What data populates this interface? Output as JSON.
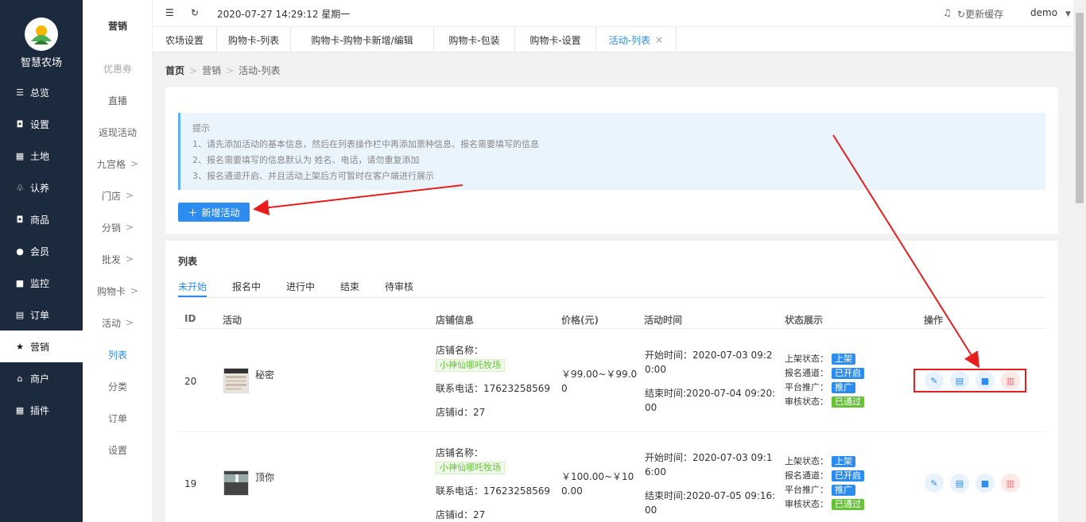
{
  "brand": {
    "name": "智慧农场"
  },
  "sidebar": {
    "items": [
      {
        "label": "总览",
        "icon": "sliders-icon"
      },
      {
        "label": "设置",
        "icon": "bag-icon"
      },
      {
        "label": "土地",
        "icon": "grid-icon"
      },
      {
        "label": "认养",
        "icon": "tree-icon"
      },
      {
        "label": "商品",
        "icon": "bag-icon"
      },
      {
        "label": "会员",
        "icon": "user-icon"
      },
      {
        "label": "监控",
        "icon": "camera-icon"
      },
      {
        "label": "订单",
        "icon": "clipboard-icon"
      },
      {
        "label": "营销",
        "icon": "star-icon"
      },
      {
        "label": "商户",
        "icon": "shop-icon"
      },
      {
        "label": "插件",
        "icon": "grid-icon"
      }
    ]
  },
  "submenu": {
    "title": "营销",
    "items": [
      {
        "label": "优惠券",
        "chev": ""
      },
      {
        "label": "直播",
        "chev": ""
      },
      {
        "label": "返现活动",
        "chev": ""
      },
      {
        "label": "九宫格",
        "chev": ">"
      },
      {
        "label": "门店",
        "chev": ">"
      },
      {
        "label": "分销",
        "chev": ">"
      },
      {
        "label": "批发",
        "chev": ">"
      },
      {
        "label": "购物卡",
        "chev": ">"
      },
      {
        "label": "活动",
        "chev": ">"
      },
      {
        "label": "列表",
        "chev": ""
      },
      {
        "label": "分类",
        "chev": ""
      },
      {
        "label": "订单",
        "chev": ""
      },
      {
        "label": "设置",
        "chev": ""
      }
    ]
  },
  "topbar": {
    "datetime": "2020-07-27 14:29:12 星期一",
    "refresh_cache": "更新缓存",
    "user": "demo"
  },
  "tabs": [
    "农场设置",
    "购物卡-列表",
    "购物卡-购物卡新增/编辑",
    "购物卡-包装",
    "购物卡-设置",
    "活动-列表"
  ],
  "breadcrumb": {
    "home": "首页",
    "level1": "营销",
    "level2": "活动-列表"
  },
  "tips": {
    "title": "提示",
    "lines": [
      "1、请先添加活动的基本信息，然后在列表操作栏中再添加票种信息、报名需要填写的信息",
      "2、报名需要填写的信息默认为 姓名、电话，请勿重复添加",
      "3、报名通道开启、并且活动上架后方可暂时在客户端进行展示"
    ]
  },
  "add_button": "新增活动",
  "list": {
    "title": "列表",
    "status_tabs": [
      "未开始",
      "报名中",
      "进行中",
      "结束",
      "待审核"
    ],
    "columns": [
      "ID",
      "活动",
      "店铺信息",
      "价格(元)",
      "活动时间",
      "状态展示",
      "操作"
    ],
    "labels": {
      "shop_name": "店铺名称：",
      "phone": "联系电话：",
      "shop_id": "店铺id：",
      "start": "开始时间：",
      "end": "结束时间:",
      "state_online": "上架状态：",
      "state_channel": "报名通道：",
      "state_promo": "平台推广：",
      "state_audit": "审核状态："
    },
    "rows": [
      {
        "id": "20",
        "name": "秘密",
        "shop": "小神仙哪吒牧场",
        "phone": "17623258569",
        "shop_id": "27",
        "price_a": "￥99.00~￥99.0",
        "price_b": "0",
        "start_a": "开始时间：2020-07-03 09:2",
        "start_b": "0:00",
        "end_a": "结束时间:2020-07-04 09:20:",
        "end_b": "00",
        "online": "上架",
        "channel": "已开启",
        "promo": "推广",
        "audit": "已通过"
      },
      {
        "id": "19",
        "name": "顶你",
        "shop": "小神仙哪吒牧场",
        "phone": "17623258569",
        "shop_id": "27",
        "price_a": "￥100.00~￥10",
        "price_b": "0.00",
        "start_a": "开始时间：2020-07-03 09:1",
        "start_b": "6:00",
        "end_a": "结束时间:2020-07-05 09:16:",
        "end_b": "00",
        "online": "上架",
        "channel": "已开启",
        "promo": "推广",
        "audit": "已通过"
      }
    ]
  },
  "colors": {
    "sidebar": "#1c2a3d",
    "primary": "#2d8cf0",
    "success": "#67c23a",
    "danger": "#f56c6c",
    "annotation": "#e81e1e"
  }
}
